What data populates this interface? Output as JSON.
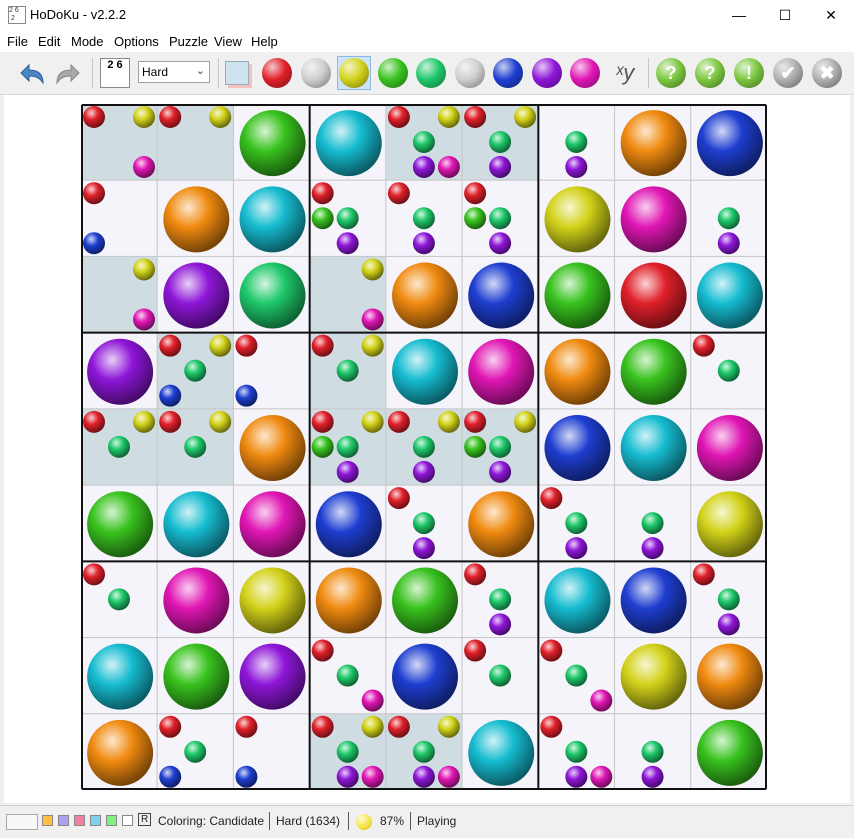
{
  "window": {
    "title": "HoDoKu - v2.2.2",
    "icon": "app-sudoku-icon",
    "minimize": "—",
    "maximize": "☐",
    "close": "✕"
  },
  "menu": [
    "File",
    "Edit",
    "Mode",
    "Options",
    "Puzzle",
    "View",
    "Help"
  ],
  "toolbar": {
    "undo": "undo-icon",
    "redo": "redo-icon",
    "level": "Hard",
    "level_icon_text": "2 6",
    "color_buttons": [
      "red",
      "silver",
      "yellow",
      "green",
      "emerald",
      "silver",
      "blue",
      "purple",
      "magenta"
    ],
    "active_color_index": 2,
    "xy_label": "ˣy",
    "hint_buttons": [
      "?",
      "?",
      "!",
      "✔",
      "✖"
    ]
  },
  "colors": {
    "1": "#e0202a",
    "2": "#d2d21a",
    "3": "#38c21e",
    "4": "#1ec86a",
    "5": "#16bcd0",
    "6": "#f08a10",
    "7": "#1e3ed0",
    "8": "#8e16d8",
    "9": "#e016b4"
  },
  "puzzle": {
    "values": [
      [
        0,
        0,
        3,
        5,
        0,
        0,
        0,
        6,
        7
      ],
      [
        0,
        6,
        5,
        0,
        0,
        0,
        2,
        9,
        0
      ],
      [
        0,
        8,
        4,
        0,
        6,
        7,
        3,
        1,
        5
      ],
      [
        8,
        0,
        0,
        0,
        5,
        9,
        6,
        3,
        0
      ],
      [
        0,
        0,
        6,
        0,
        0,
        0,
        7,
        5,
        9
      ],
      [
        3,
        5,
        9,
        7,
        0,
        6,
        0,
        0,
        2
      ],
      [
        0,
        9,
        2,
        6,
        3,
        0,
        5,
        7,
        0
      ],
      [
        5,
        3,
        8,
        0,
        7,
        0,
        0,
        2,
        6
      ],
      [
        6,
        0,
        0,
        0,
        0,
        5,
        0,
        0,
        3
      ]
    ],
    "candidates": [
      [
        [
          1,
          2,
          9
        ],
        [
          1,
          2
        ],
        [],
        [],
        [
          1,
          2,
          4,
          8,
          9
        ],
        [
          1,
          2,
          4,
          8
        ],
        [
          4,
          8
        ],
        [],
        []
      ],
      [
        [
          1,
          7
        ],
        [],
        [],
        [
          1,
          3,
          4,
          8
        ],
        [
          1,
          4,
          8
        ],
        [
          1,
          3,
          4,
          8
        ],
        [],
        [],
        [
          4,
          8
        ]
      ],
      [
        [
          2,
          9
        ],
        [],
        [],
        [
          2,
          9
        ],
        [],
        [],
        [],
        [],
        []
      ],
      [
        [],
        [
          1,
          2,
          4,
          7
        ],
        [
          1,
          7
        ],
        [
          1,
          2,
          4
        ],
        [],
        [],
        [],
        [],
        [
          1,
          4
        ]
      ],
      [
        [
          1,
          2,
          4
        ],
        [
          1,
          2,
          4
        ],
        [],
        [
          1,
          2,
          3,
          4,
          8
        ],
        [
          1,
          2,
          4,
          8
        ],
        [
          1,
          2,
          3,
          4,
          8
        ],
        [],
        [],
        []
      ],
      [
        [],
        [],
        [],
        [],
        [
          1,
          4,
          8
        ],
        [],
        [
          1,
          4,
          8
        ],
        [
          4,
          8
        ],
        []
      ],
      [
        [
          1,
          4
        ],
        [],
        [],
        [],
        [],
        [
          1,
          4,
          8
        ],
        [],
        [],
        [
          1,
          4,
          8
        ]
      ],
      [
        [],
        [],
        [],
        [
          1,
          4,
          9
        ],
        [],
        [
          1,
          4
        ],
        [
          1,
          4,
          9
        ],
        [],
        []
      ],
      [
        [],
        [
          1,
          4,
          7
        ],
        [
          1,
          7
        ],
        [
          1,
          2,
          4,
          8,
          9
        ],
        [
          1,
          2,
          4,
          8,
          9
        ],
        [],
        [
          1,
          4,
          8,
          9
        ],
        [
          4,
          8
        ],
        []
      ]
    ],
    "highlighted": [
      [
        1,
        1,
        0,
        0,
        1,
        1,
        0,
        0,
        0
      ],
      [
        0,
        0,
        0,
        0,
        0,
        0,
        0,
        0,
        0
      ],
      [
        1,
        0,
        0,
        1,
        0,
        0,
        0,
        0,
        0
      ],
      [
        0,
        1,
        0,
        1,
        0,
        0,
        0,
        0,
        0
      ],
      [
        1,
        1,
        0,
        1,
        1,
        1,
        0,
        0,
        0
      ],
      [
        0,
        0,
        0,
        0,
        0,
        0,
        0,
        0,
        0
      ],
      [
        0,
        0,
        0,
        0,
        0,
        0,
        0,
        0,
        0
      ],
      [
        0,
        0,
        0,
        0,
        0,
        0,
        0,
        0,
        0
      ],
      [
        0,
        0,
        0,
        1,
        1,
        0,
        0,
        0,
        0
      ]
    ]
  },
  "statusbar": {
    "swatches": [
      "#ffc040",
      "#b0a0f0",
      "#f080a0",
      "#80d0f0",
      "#80f080",
      "#ffffff"
    ],
    "reset_label": "R",
    "coloring": "Coloring: Candidate",
    "difficulty": "Hard (1634)",
    "progress_percent": "87%",
    "progress_value": 87,
    "state": "Playing"
  }
}
